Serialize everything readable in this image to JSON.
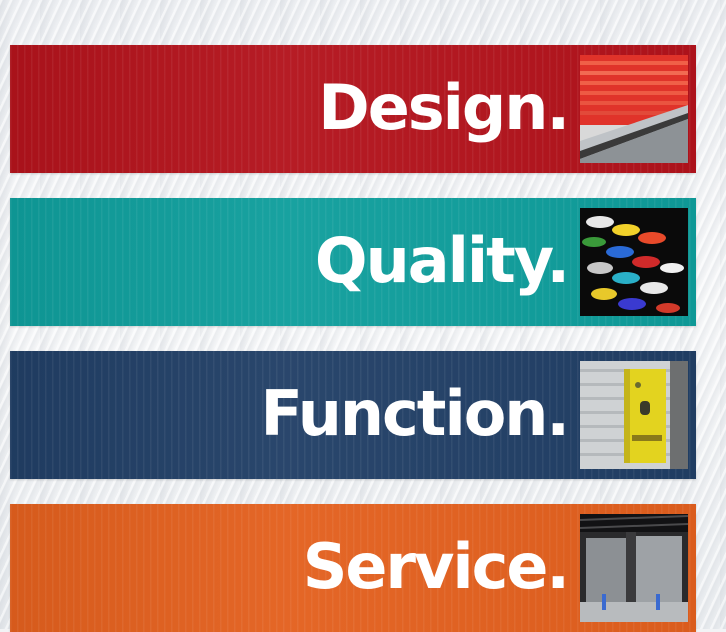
{
  "bands": [
    {
      "label": "Design.",
      "color": "#b3131c",
      "image": "red-roller-door-photo"
    },
    {
      "label": "Quality.",
      "color": "#0f9e9c",
      "image": "colored-coil-rollers-photo"
    },
    {
      "label": "Function.",
      "color": "#213f66",
      "image": "yellow-control-box-photo"
    },
    {
      "label": "Service.",
      "color": "#e3601e",
      "image": "warehouse-doors-photo"
    }
  ]
}
